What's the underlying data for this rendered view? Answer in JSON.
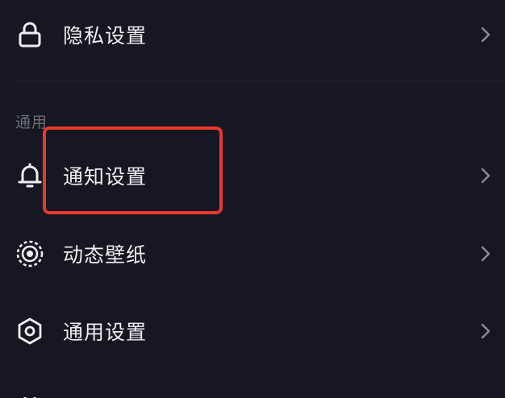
{
  "menu": {
    "privacy": {
      "label": "隐私设置",
      "icon": "lock-icon"
    },
    "section_general": "通用",
    "notifications": {
      "label": "通知设置",
      "icon": "bell-icon"
    },
    "wallpaper": {
      "label": "动态壁纸",
      "icon": "dynamic-wallpaper-icon"
    },
    "general": {
      "label": "通用设置",
      "icon": "gear-icon"
    }
  },
  "colors": {
    "background": "#161722",
    "text": "#EEEEF2",
    "muted": "#6C6D78",
    "highlight": "#E8392B"
  }
}
